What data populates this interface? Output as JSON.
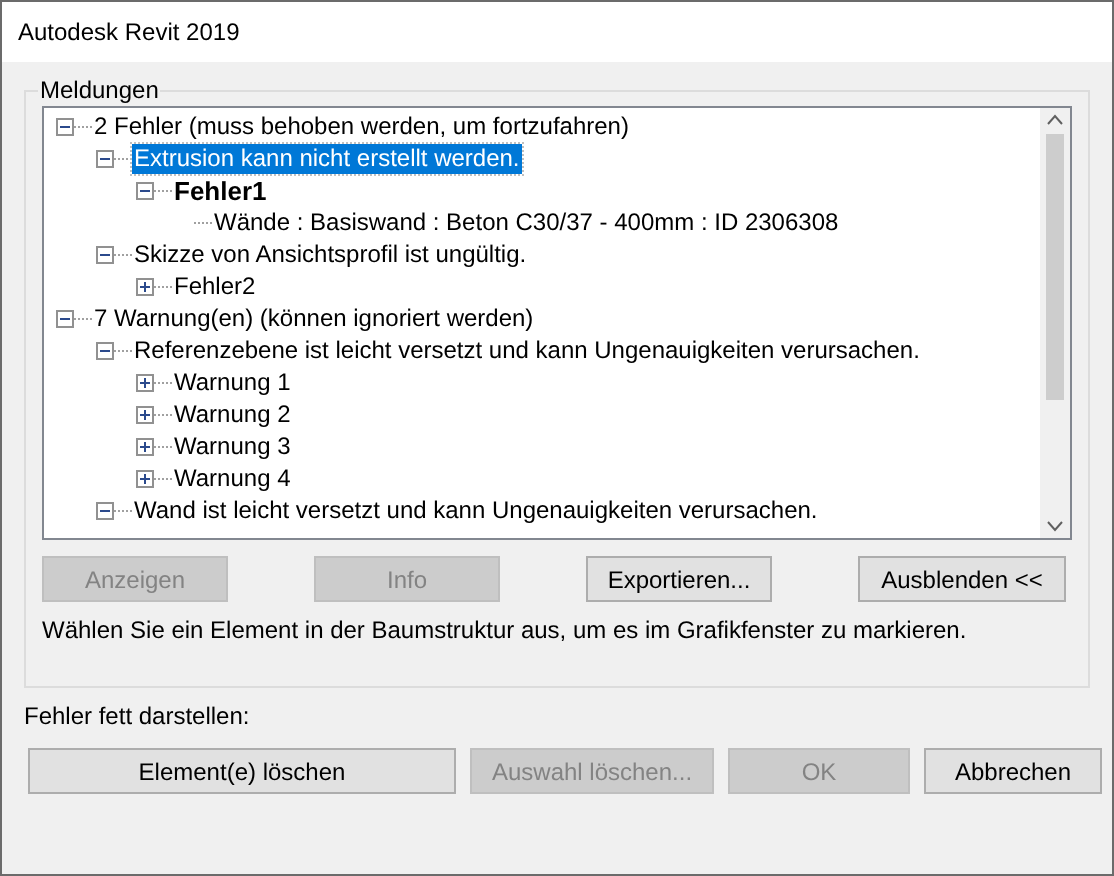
{
  "window": {
    "title": "Autodesk Revit 2019"
  },
  "group": {
    "title": "Meldungen"
  },
  "tree": [
    {
      "kind": "group",
      "text": "2 Fehler (muss behoben werden, um fortzufahren)",
      "expanded": true,
      "selected": false,
      "bold": false,
      "children": [
        {
          "kind": "group",
          "text": "Extrusion kann nicht erstellt werden.",
          "expanded": true,
          "selected": true,
          "bold": false,
          "children": [
            {
              "kind": "group",
              "text": "Fehler1",
              "expanded": true,
              "selected": false,
              "bold": true,
              "children": [
                {
                  "kind": "leaf",
                  "text": "Wände : Basiswand : Beton C30/37 - 400mm : ID 2306308",
                  "selected": false,
                  "bold": false
                }
              ]
            }
          ]
        },
        {
          "kind": "group",
          "text": "Skizze von Ansichtsprofil ist ungültig.",
          "expanded": true,
          "selected": false,
          "bold": false,
          "children": [
            {
              "kind": "group",
              "text": "Fehler2",
              "expanded": false,
              "selected": false,
              "bold": false
            }
          ]
        }
      ]
    },
    {
      "kind": "group",
      "text": "7 Warnung(en) (können ignoriert werden)",
      "expanded": true,
      "selected": false,
      "bold": false,
      "children": [
        {
          "kind": "group",
          "text": "Referenzebene ist leicht versetzt und kann Ungenauigkeiten verursachen.",
          "expanded": true,
          "selected": false,
          "bold": false,
          "children": [
            {
              "kind": "group",
              "text": "Warnung 1",
              "expanded": false,
              "selected": false,
              "bold": false
            },
            {
              "kind": "group",
              "text": "Warnung 2",
              "expanded": false,
              "selected": false,
              "bold": false
            },
            {
              "kind": "group",
              "text": "Warnung 3",
              "expanded": false,
              "selected": false,
              "bold": false
            },
            {
              "kind": "group",
              "text": "Warnung 4",
              "expanded": false,
              "selected": false,
              "bold": false
            }
          ]
        },
        {
          "kind": "group",
          "text": "Wand ist leicht versetzt und kann Ungenauigkeiten verursachen.",
          "expanded": true,
          "selected": false,
          "bold": false
        }
      ]
    }
  ],
  "tree_buttons": [
    {
      "label": "Anzeigen",
      "disabled": true
    },
    {
      "label": "Info",
      "disabled": true
    },
    {
      "label": "Exportieren...",
      "disabled": false
    },
    {
      "label": "Ausblenden <<",
      "disabled": false
    }
  ],
  "hint": "Wählen Sie ein Element in der Baumstruktur aus, um es im Grafikfenster zu markieren.",
  "bold_label": "Fehler fett darstellen:",
  "buttons": [
    {
      "label": "Element(e) löschen",
      "disabled": false
    },
    {
      "label": "Auswahl löschen...",
      "disabled": true
    },
    {
      "label": "OK",
      "disabled": true
    },
    {
      "label": "Abbrechen",
      "disabled": false
    }
  ]
}
